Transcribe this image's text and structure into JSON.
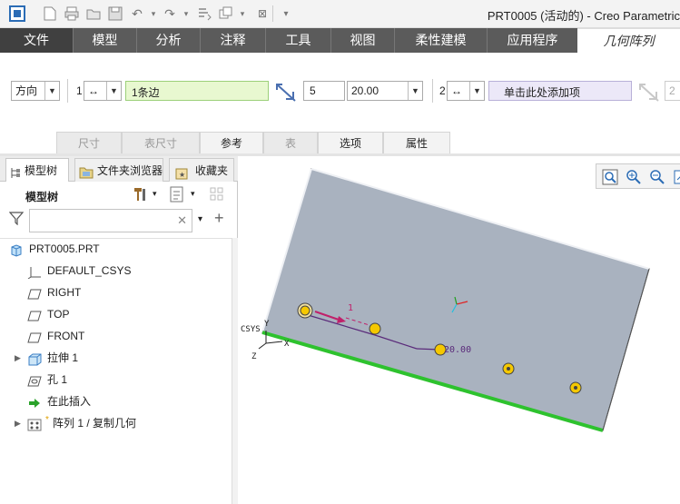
{
  "window": {
    "title": "PRT0005 (活动的) - Creo Parametric"
  },
  "ribbon": {
    "tabs": [
      {
        "label": "文件"
      },
      {
        "label": "模型"
      },
      {
        "label": "分析"
      },
      {
        "label": "注释"
      },
      {
        "label": "工具"
      },
      {
        "label": "视图"
      },
      {
        "label": "柔性建模"
      },
      {
        "label": "应用程序"
      },
      {
        "label": "几何阵列"
      }
    ]
  },
  "dashboard": {
    "pattern_type": "方向",
    "dir1": {
      "index": "1",
      "reference": "1条边",
      "count": "5",
      "spacing": "20.00"
    },
    "dir2": {
      "index": "2",
      "reference": "单击此处添加项",
      "count": "2"
    },
    "subtabs": [
      {
        "label": "尺寸"
      },
      {
        "label": "表尺寸"
      },
      {
        "label": "参考"
      },
      {
        "label": "表"
      },
      {
        "label": "选项"
      },
      {
        "label": "属性"
      }
    ]
  },
  "left_panel": {
    "tabs": [
      {
        "label": "模型树"
      },
      {
        "label": "文件夹浏览器"
      },
      {
        "label": "收藏夹"
      }
    ],
    "tree_label": "模型树",
    "search_value": "",
    "tree": [
      {
        "label": "PRT0005.PRT",
        "icon": "part-icon"
      },
      {
        "label": "DEFAULT_CSYS",
        "icon": "csys-icon"
      },
      {
        "label": "RIGHT",
        "icon": "plane-icon"
      },
      {
        "label": "TOP",
        "icon": "plane-icon"
      },
      {
        "label": "FRONT",
        "icon": "plane-icon"
      },
      {
        "label": "拉伸 1",
        "icon": "extrude-icon"
      },
      {
        "label": "孔 1",
        "icon": "hole-icon"
      },
      {
        "label": "在此插入",
        "icon": "insert-arrow-icon"
      },
      {
        "label": "阵列 1 / 复制几何",
        "icon": "pattern-icon"
      }
    ]
  },
  "graphics": {
    "csys_label": "CSYS",
    "axis_x": "X",
    "axis_y": "Y",
    "axis_z": "Z",
    "dim_count": "1",
    "dim_spacing": "20.00"
  },
  "colors": {
    "tab_bar": "#5b5b5b",
    "file_tab": "#404040",
    "part_face": "#a9b2bf",
    "edge_highlight": "#2ec22e",
    "dimension": "#5a2a7a"
  }
}
